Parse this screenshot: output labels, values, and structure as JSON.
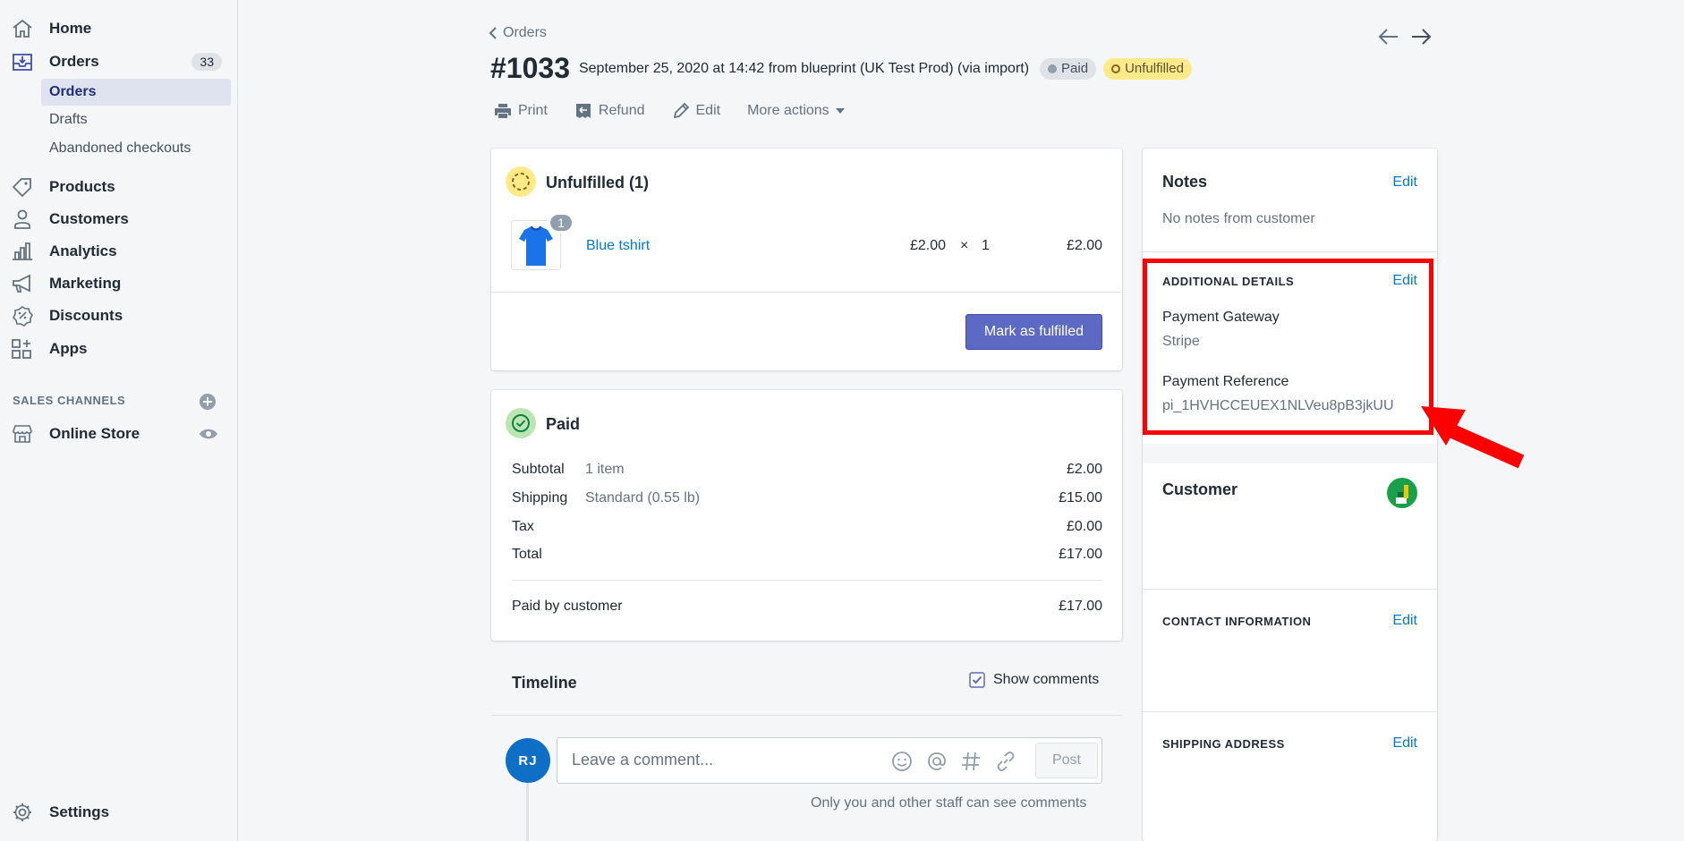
{
  "sidebar": {
    "items": [
      {
        "label": "Home",
        "icon": "home-icon"
      },
      {
        "label": "Orders",
        "icon": "orders-icon",
        "badge": "33"
      },
      {
        "label": "Products",
        "icon": "tag-icon"
      },
      {
        "label": "Customers",
        "icon": "person-icon"
      },
      {
        "label": "Analytics",
        "icon": "bar-chart-icon"
      },
      {
        "label": "Marketing",
        "icon": "megaphone-icon"
      },
      {
        "label": "Discounts",
        "icon": "discount-icon"
      },
      {
        "label": "Apps",
        "icon": "apps-icon"
      }
    ],
    "orders_sub": [
      "Orders",
      "Drafts",
      "Abandoned checkouts"
    ],
    "sales_channels_title": "SALES CHANNELS",
    "online_store": "Online Store",
    "settings": "Settings"
  },
  "header": {
    "breadcrumb": "Orders",
    "order_number": "#1033",
    "meta": "September 25, 2020 at 14:42 from blueprint (UK Test Prod) (via import)",
    "badge_paid": "Paid",
    "badge_unfulfilled": "Unfulfilled",
    "actions": {
      "print": "Print",
      "refund": "Refund",
      "edit": "Edit",
      "more": "More actions"
    }
  },
  "unfulfilled": {
    "title": "Unfulfilled (1)",
    "item": {
      "name": "Blue tshirt",
      "qty_badge": "1",
      "price": "£2.00",
      "times": "×",
      "qty": "1",
      "total": "£2.00"
    },
    "button": "Mark as fulfilled"
  },
  "paid": {
    "title": "Paid",
    "rows": [
      {
        "label": "Subtotal",
        "detail": "1 item",
        "value": "£2.00"
      },
      {
        "label": "Shipping",
        "detail": "Standard (0.55 lb)",
        "value": "£15.00"
      },
      {
        "label": "Tax",
        "detail": "",
        "value": "£0.00"
      },
      {
        "label": "Total",
        "detail": "",
        "value": "£17.00"
      }
    ],
    "paid_by_label": "Paid by customer",
    "paid_by_value": "£17.00"
  },
  "timeline": {
    "title": "Timeline",
    "show_comments": "Show comments",
    "avatar": "RJ",
    "placeholder": "Leave a comment...",
    "post": "Post",
    "note": "Only you and other staff can see comments"
  },
  "notes": {
    "title": "Notes",
    "edit": "Edit",
    "text": "No notes from customer"
  },
  "additional": {
    "title": "ADDITIONAL DETAILS",
    "edit": "Edit",
    "gateway_label": "Payment Gateway",
    "gateway_value": "Stripe",
    "reference_label": "Payment Reference",
    "reference_value": "pi_1HVHCCEUEX1NLVeu8pB3jkUU"
  },
  "customer": {
    "title": "Customer"
  },
  "contact": {
    "title": "CONTACT INFORMATION",
    "edit": "Edit"
  },
  "shipping": {
    "title": "SHIPPING ADDRESS",
    "edit": "Edit"
  },
  "colors": {
    "accent": "#5c6ac4",
    "link": "#007ace",
    "highlight": "#ff0000"
  }
}
